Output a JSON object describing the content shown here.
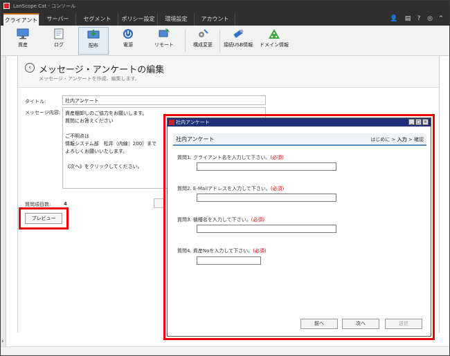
{
  "app": {
    "title": "LanScope Cat - コンソール"
  },
  "tabs": [
    {
      "label": "クライアント",
      "active": true
    },
    {
      "label": "サーバー"
    },
    {
      "label": "セグメント"
    },
    {
      "label": "ポリシー設定"
    },
    {
      "label": "環境設定"
    },
    {
      "label": "アカウント"
    }
  ],
  "toolbar": {
    "items": [
      {
        "label": "資産",
        "icon": "monitor-icon"
      },
      {
        "label": "ログ",
        "icon": "log-icon"
      },
      {
        "label": "配布",
        "icon": "distribute-icon",
        "selected": true
      },
      {
        "label": "電源",
        "icon": "power-icon"
      },
      {
        "label": "リモート",
        "icon": "remote-icon"
      },
      {
        "label": "構成変更",
        "icon": "config-icon"
      },
      {
        "label": "接続USB情報",
        "icon": "usb-icon"
      },
      {
        "label": "ドメイン情報",
        "icon": "domain-icon"
      }
    ]
  },
  "page": {
    "title": "メッセージ・アンケートの編集",
    "subtitle": "メッセージ・アンケートを作成、編集します。"
  },
  "form": {
    "title_label": "タイトル:",
    "title_value": "社内アンケート",
    "content_label": "メッセージ内容:",
    "content_lines": [
      "資産棚卸しのご協力をお願いします。",
      "質問にお答えください",
      "",
      "ご不明点は",
      "情報システム部　松井（内線：200）まで",
      "よろしくお願いいたします。",
      "",
      "《次へ》をクリックしてください。"
    ],
    "question_count_label": "質問項目数:",
    "question_count": "4",
    "preview_button": "プレビュー"
  },
  "dialog": {
    "title": "社内アンケート",
    "header_title": "社内アンケート",
    "steps": {
      "start": "はじめに",
      "sep": ">",
      "input": "入力",
      "confirm": "確認"
    },
    "questions": [
      {
        "label": "質問1. クライアント名を入力して下さい。",
        "required": "(必須)"
      },
      {
        "label": "質問2. E-Mailアドレスを入力して下さい。",
        "required": "(必須)"
      },
      {
        "label": "質問3. 機種名を入力して下さい。",
        "required": "(必須)"
      },
      {
        "label": "質問4. 資産Noを入力して下さい。",
        "required": "(必須)"
      }
    ],
    "buttons": {
      "prev": "前へ",
      "next": "次へ",
      "send": "送信"
    }
  },
  "colors": {
    "highlight": "#e00000",
    "dialog_titlebar": "#1f2f7a",
    "accent": "#cc6600"
  }
}
